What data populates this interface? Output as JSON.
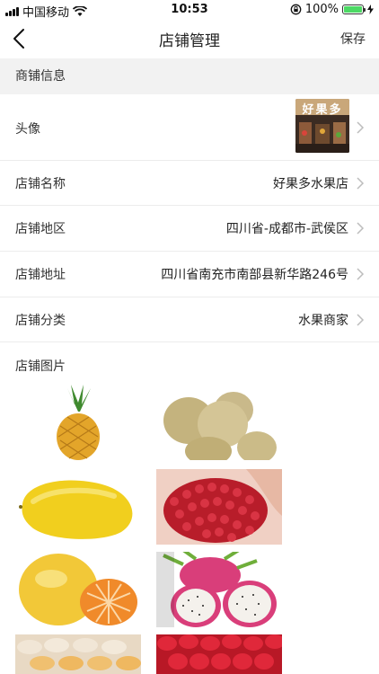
{
  "status_bar": {
    "carrier": "中国移动",
    "time": "10:53",
    "battery": "100%"
  },
  "nav": {
    "title": "店铺管理",
    "save_label": "保存"
  },
  "section": {
    "title": "商铺信息"
  },
  "rows": {
    "avatar": {
      "label": "头像",
      "avatar_text": "好果多"
    },
    "name": {
      "label": "店铺名称",
      "value": "好果多水果店"
    },
    "region": {
      "label": "店铺地区",
      "value": "四川省-成都市-武侯区"
    },
    "address": {
      "label": "店铺地址",
      "value": "四川省南充市南部县新华路246号"
    },
    "category": {
      "label": "店铺分类",
      "value": "水果商家"
    }
  },
  "photos": {
    "label": "店铺图片"
  },
  "colors": {
    "accent_battery": "#4cd964",
    "section_bg": "#f2f2f2",
    "divider": "#ececec"
  },
  "icons": [
    "wifi-icon",
    "signal-icon",
    "battery-icon",
    "lock-rotation-icon",
    "back-chevron-icon",
    "chevron-right-icon"
  ]
}
